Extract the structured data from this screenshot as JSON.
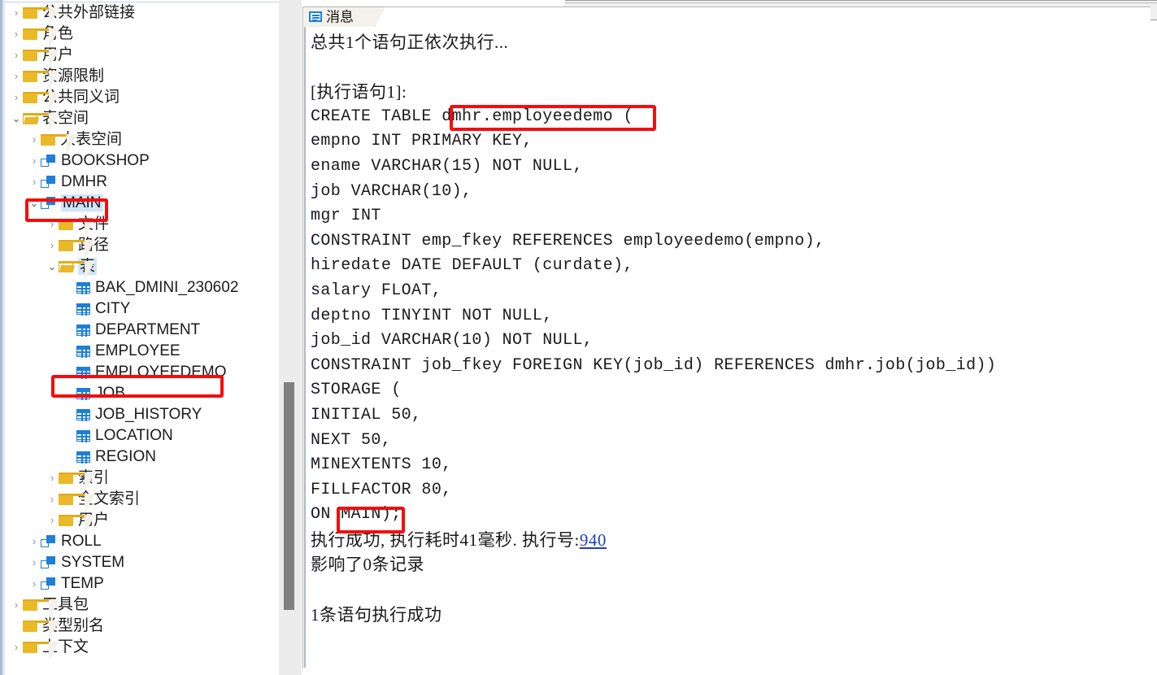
{
  "window": {
    "left_panel_name": "database-object-tree",
    "right_panel_name": "message-console"
  },
  "tree": {
    "items": [
      {
        "label": "公共外部链接",
        "icon": "folder-icon",
        "indent": 0,
        "expander": "right",
        "selected": false
      },
      {
        "label": "角色",
        "icon": "folder-icon",
        "indent": 0,
        "expander": "right",
        "selected": false
      },
      {
        "label": "用户",
        "icon": "folder-icon",
        "indent": 0,
        "expander": "right",
        "selected": false
      },
      {
        "label": "资源限制",
        "icon": "folder-icon",
        "indent": 0,
        "expander": "right",
        "selected": false
      },
      {
        "label": "公共同义词",
        "icon": "folder-icon",
        "indent": 0,
        "expander": "right",
        "selected": false
      },
      {
        "label": "表空间",
        "icon": "folder-open-icon",
        "indent": 0,
        "expander": "down",
        "selected": false
      },
      {
        "label": "大表空间",
        "icon": "folder-icon",
        "indent": 1,
        "expander": "right",
        "selected": false
      },
      {
        "label": "BOOKSHOP",
        "icon": "tablespace-icon",
        "indent": 1,
        "expander": "right",
        "selected": false
      },
      {
        "label": "DMHR",
        "icon": "tablespace-icon",
        "indent": 1,
        "expander": "right",
        "selected": false
      },
      {
        "label": "MAIN",
        "icon": "tablespace-icon",
        "indent": 1,
        "expander": "down",
        "selected": true
      },
      {
        "label": "文件",
        "icon": "folder-icon",
        "indent": 2,
        "expander": "right",
        "selected": false
      },
      {
        "label": "路径",
        "icon": "folder-icon",
        "indent": 2,
        "expander": "right",
        "selected": false
      },
      {
        "label": "表",
        "icon": "folder-open-icon",
        "indent": 2,
        "expander": "down",
        "selected": true
      },
      {
        "label": "BAK_DMINI_230602",
        "icon": "table-icon",
        "indent": 3,
        "expander": "none",
        "selected": false
      },
      {
        "label": "CITY",
        "icon": "table-icon",
        "indent": 3,
        "expander": "none",
        "selected": false
      },
      {
        "label": "DEPARTMENT",
        "icon": "table-icon",
        "indent": 3,
        "expander": "none",
        "selected": false
      },
      {
        "label": "EMPLOYEE",
        "icon": "table-icon",
        "indent": 3,
        "expander": "none",
        "selected": false
      },
      {
        "label": "EMPLOYEEDEMO",
        "icon": "table-icon",
        "indent": 3,
        "expander": "none",
        "selected": false
      },
      {
        "label": "JOB",
        "icon": "table-icon",
        "indent": 3,
        "expander": "none",
        "selected": false
      },
      {
        "label": "JOB_HISTORY",
        "icon": "table-icon",
        "indent": 3,
        "expander": "none",
        "selected": false
      },
      {
        "label": "LOCATION",
        "icon": "table-icon",
        "indent": 3,
        "expander": "none",
        "selected": false
      },
      {
        "label": "REGION",
        "icon": "table-icon",
        "indent": 3,
        "expander": "none",
        "selected": false
      },
      {
        "label": "索引",
        "icon": "folder-icon",
        "indent": 2,
        "expander": "right",
        "selected": false
      },
      {
        "label": "全文索引",
        "icon": "folder-icon",
        "indent": 2,
        "expander": "right",
        "selected": false
      },
      {
        "label": "用户",
        "icon": "folder-icon",
        "indent": 2,
        "expander": "right",
        "selected": false
      },
      {
        "label": "ROLL",
        "icon": "tablespace-icon",
        "indent": 1,
        "expander": "right",
        "selected": false
      },
      {
        "label": "SYSTEM",
        "icon": "tablespace-icon",
        "indent": 1,
        "expander": "right",
        "selected": false
      },
      {
        "label": "TEMP",
        "icon": "tablespace-icon",
        "indent": 1,
        "expander": "right",
        "selected": false
      },
      {
        "label": "工具包",
        "icon": "folder-icon",
        "indent": 0,
        "expander": "right",
        "selected": false
      },
      {
        "label": "类型别名",
        "icon": "folder-icon",
        "indent": 0,
        "expander": "none",
        "selected": false
      },
      {
        "label": "上下文",
        "icon": "folder-icon",
        "indent": 0,
        "expander": "right",
        "selected": false
      }
    ],
    "highlight_boxes": [
      {
        "name": "highlight-main-tablespace",
        "target": "MAIN"
      },
      {
        "name": "highlight-employeedemo-table",
        "target": "EMPLOYEEDEMO"
      }
    ],
    "scrollbar": {
      "name": "tree-vertical-scrollbar"
    }
  },
  "message_panel": {
    "tab": {
      "label": "消息",
      "icon": "message-icon"
    },
    "lines": [
      {
        "text": "总共1个语句正依次执行...",
        "style": "cn"
      },
      {
        "text": "",
        "style": "mono"
      },
      {
        "text": "[执行语句1]:",
        "style": "cn"
      },
      {
        "text": "CREATE TABLE dmhr.employeedemo (",
        "style": "mono"
      },
      {
        "text": "empno INT PRIMARY KEY,",
        "style": "mono"
      },
      {
        "text": "ename VARCHAR(15) NOT NULL,",
        "style": "mono"
      },
      {
        "text": "job VARCHAR(10),",
        "style": "mono"
      },
      {
        "text": "mgr INT",
        "style": "mono"
      },
      {
        "text": "CONSTRAINT emp_fkey REFERENCES employeedemo(empno),",
        "style": "mono"
      },
      {
        "text": "hiredate DATE DEFAULT (curdate),",
        "style": "mono"
      },
      {
        "text": "salary FLOAT,",
        "style": "mono"
      },
      {
        "text": "deptno TINYINT NOT NULL,",
        "style": "mono"
      },
      {
        "text": "job_id VARCHAR(10) NOT NULL,",
        "style": "mono"
      },
      {
        "text": "CONSTRAINT job_fkey FOREIGN KEY(job_id) REFERENCES dmhr.job(job_id))",
        "style": "mono"
      },
      {
        "text": "STORAGE (",
        "style": "mono"
      },
      {
        "text": "INITIAL 50,",
        "style": "mono"
      },
      {
        "text": "NEXT 50,",
        "style": "mono"
      },
      {
        "text": "MINEXTENTS 10,",
        "style": "mono"
      },
      {
        "text": "FILLFACTOR 80,",
        "style": "mono"
      },
      {
        "text": "ON MAIN);",
        "style": "mono"
      }
    ],
    "result_line": {
      "prefix": "执行成功, 执行耗时41毫秒. 执行号:",
      "exec_id": "940"
    },
    "affected_line": "影响了0条记录",
    "blank_line": "",
    "summary_line": "1条语句执行成功",
    "highlight_boxes": [
      {
        "name": "highlight-table-name",
        "target": "dmhr.employeedemo"
      },
      {
        "name": "highlight-tablespace-clause",
        "target": "MAIN)"
      }
    ]
  },
  "colors": {
    "highlight_red": "#f40d0d",
    "icon_blue": "#1d7fd6",
    "folder_yellow": "#e9b928",
    "selection_blue": "#cfe4f7",
    "link_blue": "#1f3fb8"
  }
}
